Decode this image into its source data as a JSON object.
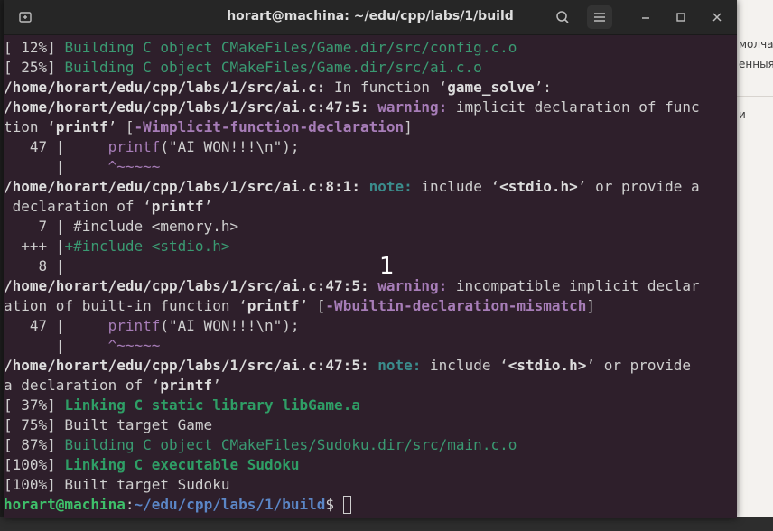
{
  "window": {
    "title": "horart@machina: ~/edu/cpp/labs/1/build"
  },
  "background_window": {
    "lines": [
      "молча",
      "енныя",
      "и"
    ]
  },
  "overlay_label": "1",
  "terminal": {
    "lines": [
      {
        "segs": [
          {
            "t": "[ 12%] ",
            "c": ""
          },
          {
            "t": "Building C object CMakeFiles/Game.dir/src/config.c.o",
            "c": "green"
          }
        ]
      },
      {
        "segs": [
          {
            "t": "[ 25%] ",
            "c": ""
          },
          {
            "t": "Building C object CMakeFiles/Game.dir/src/ai.c.o",
            "c": "green"
          }
        ]
      },
      {
        "segs": [
          {
            "t": "/home/horart/edu/cpp/labs/1/src/ai.c:",
            "c": "bold"
          },
          {
            "t": " In function ‘",
            "c": ""
          },
          {
            "t": "game_solve",
            "c": "bold"
          },
          {
            "t": "’:",
            "c": ""
          }
        ]
      },
      {
        "segs": [
          {
            "t": "/home/horart/edu/cpp/labs/1/src/ai.c:47:5:",
            "c": "bold"
          },
          {
            "t": " ",
            "c": ""
          },
          {
            "t": "warning:",
            "c": "purple"
          },
          {
            "t": " implicit declaration of func",
            "c": ""
          }
        ]
      },
      {
        "segs": [
          {
            "t": "tion ‘",
            "c": ""
          },
          {
            "t": "printf",
            "c": "bold"
          },
          {
            "t": "’ [",
            "c": ""
          },
          {
            "t": "-Wimplicit-function-declaration",
            "c": "wflag"
          },
          {
            "t": "]",
            "c": ""
          }
        ]
      },
      {
        "segs": [
          {
            "t": "   47 |     ",
            "c": ""
          },
          {
            "t": "printf",
            "c": "purp"
          },
          {
            "t": "(\"AI WON!!!\\n\");",
            "c": ""
          }
        ]
      },
      {
        "segs": [
          {
            "t": "      |     ",
            "c": ""
          },
          {
            "t": "^~~~~~",
            "c": "purp"
          }
        ]
      },
      {
        "segs": [
          {
            "t": "/home/horart/edu/cpp/labs/1/src/ai.c:8:1:",
            "c": "bold"
          },
          {
            "t": " ",
            "c": ""
          },
          {
            "t": "note:",
            "c": "teal"
          },
          {
            "t": " include ‘",
            "c": ""
          },
          {
            "t": "<stdio.h>",
            "c": "bold"
          },
          {
            "t": "’ or provide a",
            "c": ""
          }
        ]
      },
      {
        "segs": [
          {
            "t": " declaration of ‘",
            "c": ""
          },
          {
            "t": "printf",
            "c": "bold"
          },
          {
            "t": "’",
            "c": ""
          }
        ]
      },
      {
        "segs": [
          {
            "t": "    7 | #include <memory.h>",
            "c": ""
          }
        ]
      },
      {
        "segs": [
          {
            "t": "  +++ |",
            "c": ""
          },
          {
            "t": "+#include <stdio.h>",
            "c": "green"
          }
        ]
      },
      {
        "segs": [
          {
            "t": "    8 |",
            "c": ""
          }
        ]
      },
      {
        "segs": [
          {
            "t": "/home/horart/edu/cpp/labs/1/src/ai.c:47:5:",
            "c": "bold"
          },
          {
            "t": " ",
            "c": ""
          },
          {
            "t": "warning:",
            "c": "purple"
          },
          {
            "t": " incompatible implicit declar",
            "c": ""
          }
        ]
      },
      {
        "segs": [
          {
            "t": "ation of built-in function ‘",
            "c": ""
          },
          {
            "t": "printf",
            "c": "bold"
          },
          {
            "t": "’ [",
            "c": ""
          },
          {
            "t": "-Wbuiltin-declaration-mismatch",
            "c": "wflag"
          },
          {
            "t": "]",
            "c": ""
          }
        ]
      },
      {
        "segs": [
          {
            "t": "   47 |     ",
            "c": ""
          },
          {
            "t": "printf",
            "c": "purp"
          },
          {
            "t": "(\"AI WON!!!\\n\");",
            "c": ""
          }
        ]
      },
      {
        "segs": [
          {
            "t": "      |     ",
            "c": ""
          },
          {
            "t": "^~~~~~",
            "c": "purp"
          }
        ]
      },
      {
        "segs": [
          {
            "t": "/home/horart/edu/cpp/labs/1/src/ai.c:47:5:",
            "c": "bold"
          },
          {
            "t": " ",
            "c": ""
          },
          {
            "t": "note:",
            "c": "teal"
          },
          {
            "t": " include ‘",
            "c": ""
          },
          {
            "t": "<stdio.h>",
            "c": "bold"
          },
          {
            "t": "’ or provide",
            "c": ""
          }
        ]
      },
      {
        "segs": [
          {
            "t": "a declaration of ‘",
            "c": ""
          },
          {
            "t": "printf",
            "c": "bold"
          },
          {
            "t": "’",
            "c": ""
          }
        ]
      },
      {
        "segs": [
          {
            "t": "[ 37%] ",
            "c": ""
          },
          {
            "t": "Linking C static library libGame.a",
            "c": "greenb"
          }
        ]
      },
      {
        "segs": [
          {
            "t": "[ 75%] Built target Game",
            "c": ""
          }
        ]
      },
      {
        "segs": [
          {
            "t": "[ 87%] ",
            "c": ""
          },
          {
            "t": "Building C object CMakeFiles/Sudoku.dir/src/main.c.o",
            "c": "green"
          }
        ]
      },
      {
        "segs": [
          {
            "t": "[100%] ",
            "c": ""
          },
          {
            "t": "Linking C executable Sudoku",
            "c": "greenb"
          }
        ]
      },
      {
        "segs": [
          {
            "t": "[100%] Built target Sudoku",
            "c": ""
          }
        ]
      }
    ],
    "prompt": {
      "user": "horart@machina",
      "sep": ":",
      "path": "~/edu/cpp/labs/1/build",
      "symbol": "$ "
    }
  },
  "colors": {
    "terminal_bg": "#2e1f2b",
    "green": "#3a9a72",
    "warning": "#a77db8",
    "note": "#3b8c8c",
    "prompt_user": "#3ec06a",
    "prompt_path": "#5b86c6"
  },
  "icons": {
    "new_tab": "new-tab-icon",
    "search": "search-icon",
    "menu": "hamburger-menu-icon",
    "minimize": "minimize-icon",
    "maximize": "maximize-icon",
    "close": "close-icon"
  }
}
